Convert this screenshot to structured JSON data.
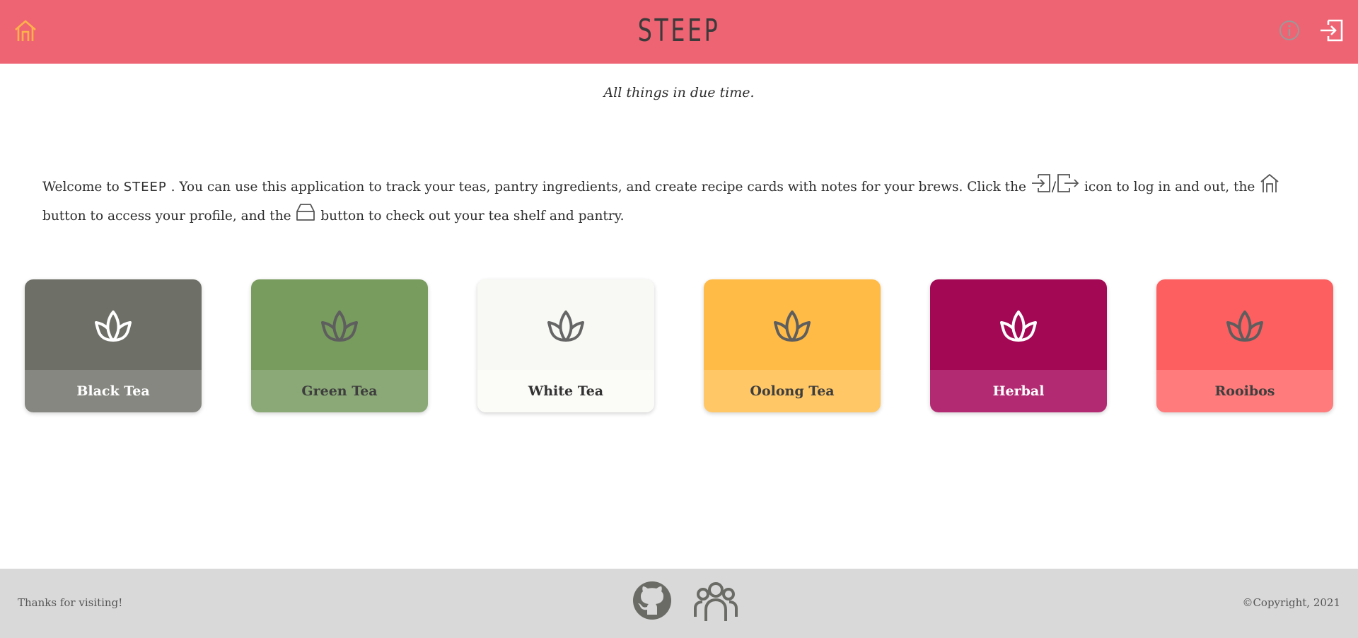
{
  "header": {
    "brand": "STEEP",
    "home_icon": "home-icon",
    "info_icon": "info-icon",
    "login_icon": "login-icon"
  },
  "tagline": "All things in due time.",
  "intro": {
    "part1": "Welcome to ",
    "brand": "STEEP",
    "part2": " . You can use this application to track your teas, pantry ingredients, and create recipe cards with notes for your brews. Click the ",
    "slash": "/",
    "part3": " icon to log in and out, the ",
    "part4": " button to access your profile, and the ",
    "part5": " button to check out your tea shelf and pantry."
  },
  "tea_cards": [
    {
      "label": "Black Tea",
      "top_color": "#6e6f67",
      "bottom_color": "#868780",
      "text_color": "#ffffff",
      "icon_color": "#ffffff",
      "icon": "lotus-icon"
    },
    {
      "label": "Green Tea",
      "top_color": "#789b5e",
      "bottom_color": "#8ba977",
      "text_color": "#3e3e3e",
      "icon_color": "#5e5e5e",
      "icon": "lotus-icon"
    },
    {
      "label": "White Tea",
      "top_color": "#f8f8f4",
      "bottom_color": "#fbfbf8",
      "text_color": "#333333",
      "icon_color": "#666666",
      "icon": "lotus-icon"
    },
    {
      "label": "Oolong Tea",
      "top_color": "#ffbb46",
      "bottom_color": "#ffc766",
      "text_color": "#3e3e3e",
      "icon_color": "#5e5e5e",
      "icon": "lotus-icon"
    },
    {
      "label": "Herbal",
      "top_color": "#a30854",
      "bottom_color": "#b22a72",
      "text_color": "#ffffff",
      "icon_color": "#ffffff",
      "icon": "lotus-icon"
    },
    {
      "label": "Rooibos",
      "top_color": "#fd5f60",
      "bottom_color": "#ff7b7c",
      "text_color": "#3e3e3e",
      "icon_color": "#5e5e5e",
      "icon": "lotus-icon"
    }
  ],
  "footer": {
    "thanks": "Thanks for visiting!",
    "copyright": "©Copyright, 2021",
    "github_icon": "github-icon",
    "team_icon": "team-icon"
  },
  "colors": {
    "header_bg": "#ee6473",
    "home_icon": "#ffb24a",
    "footer_bg": "#d9d9d9",
    "icon_gray": "#6b6b66"
  }
}
